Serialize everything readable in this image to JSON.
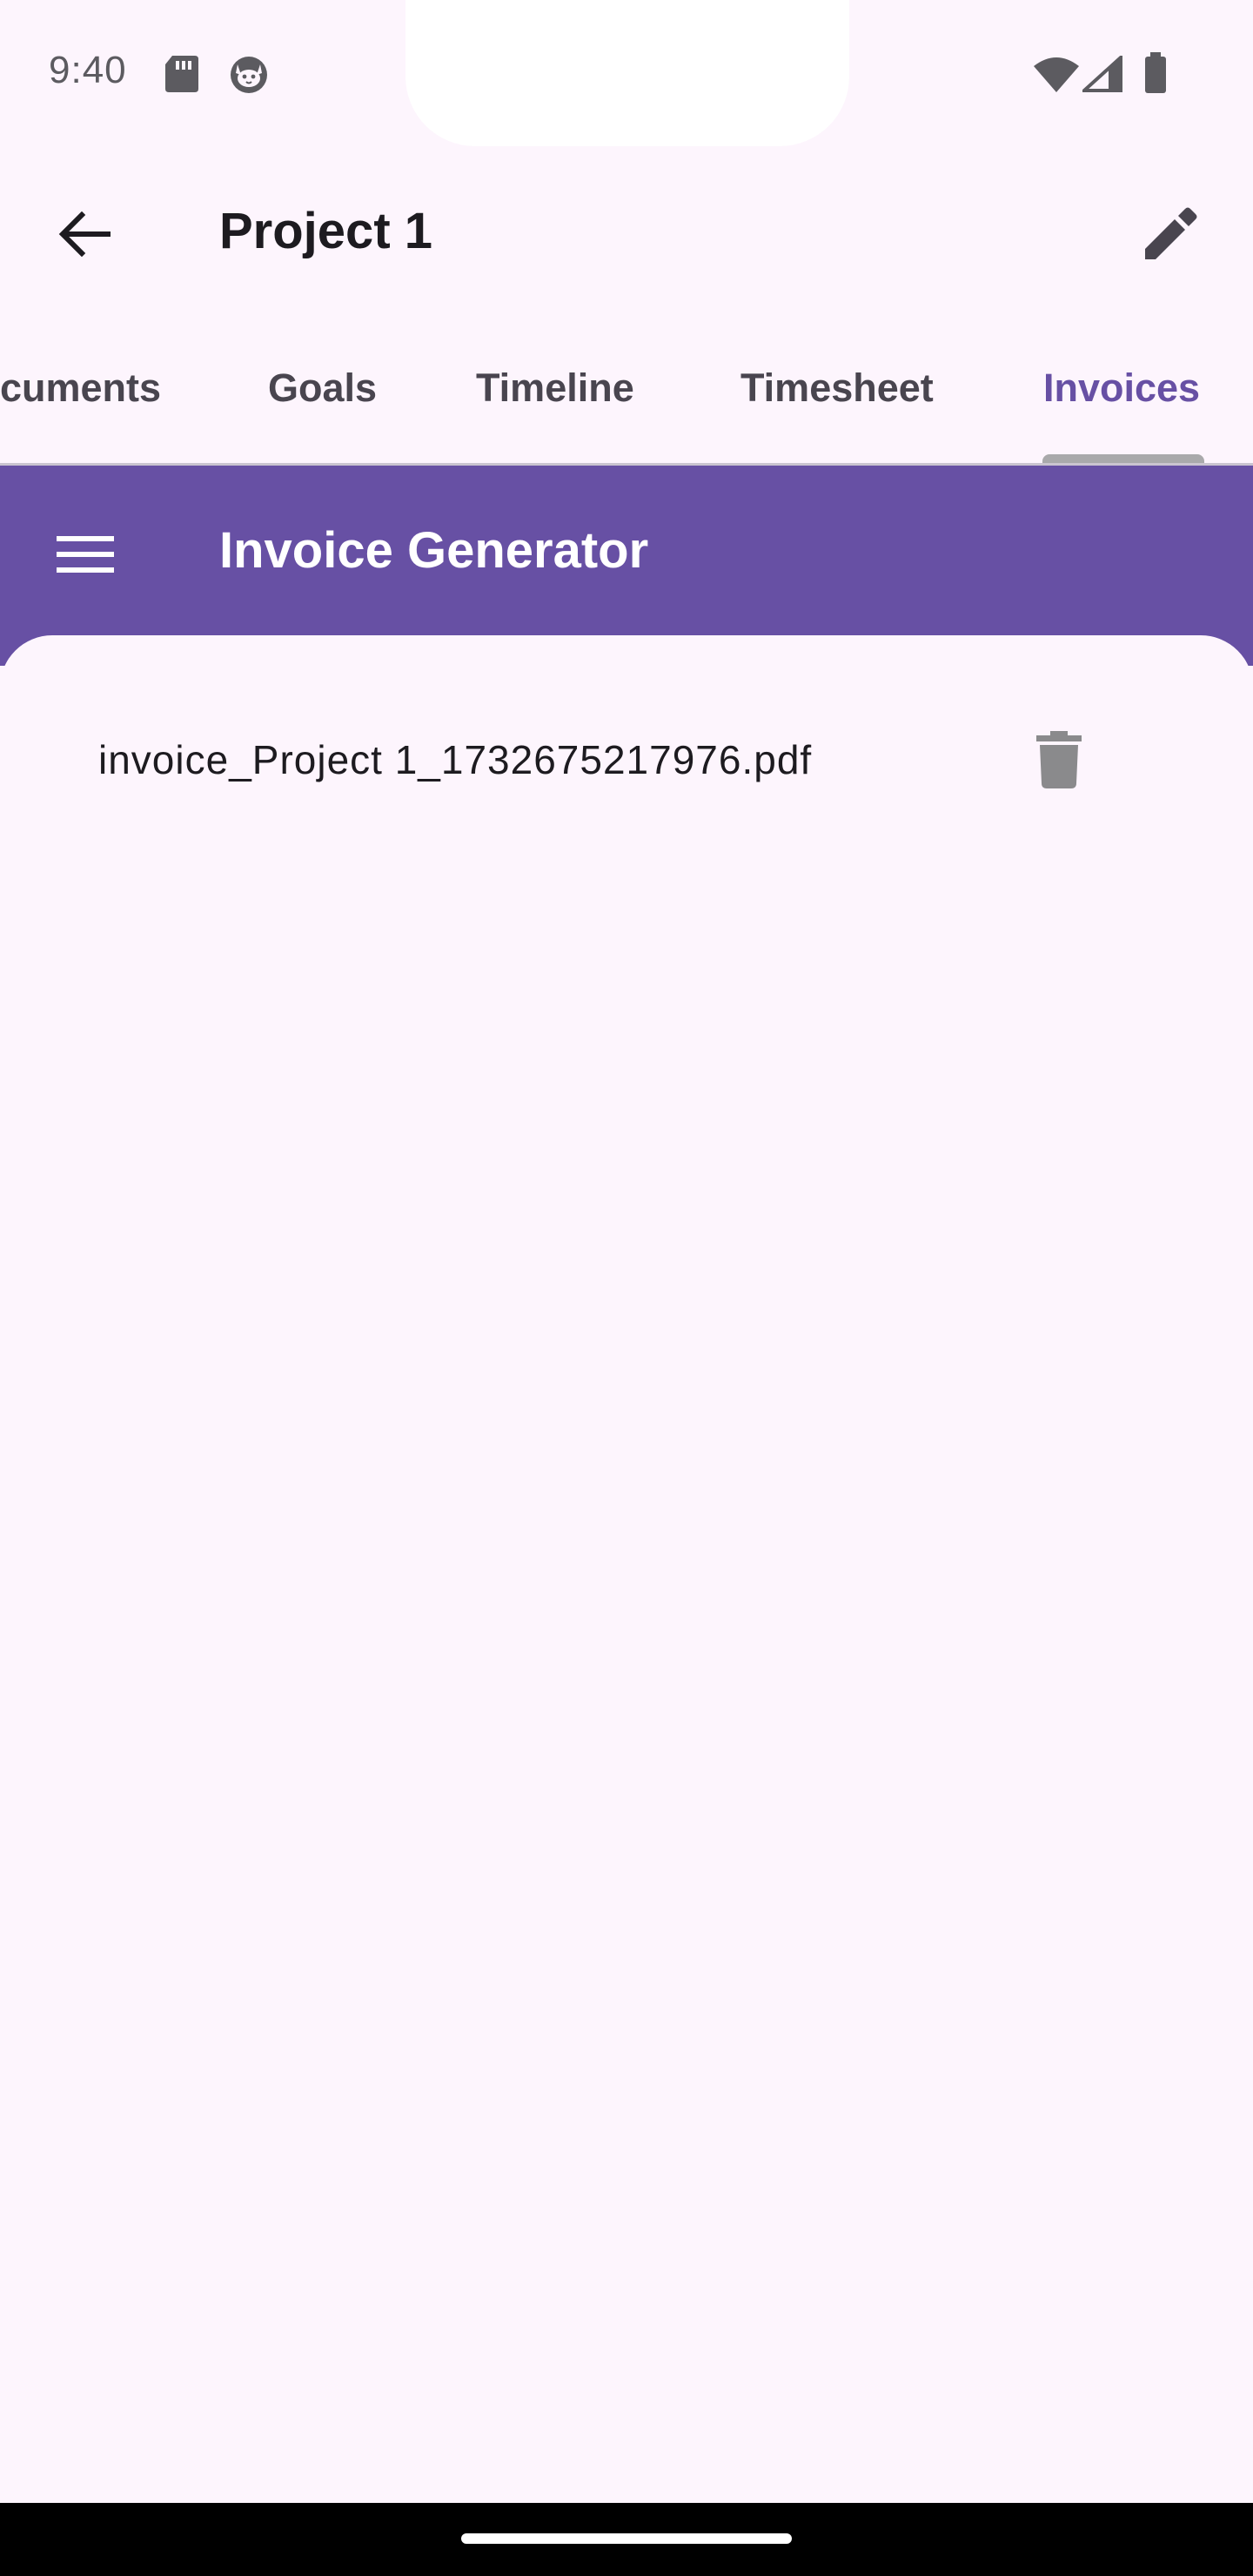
{
  "status_bar": {
    "time": "9:40",
    "icons": [
      "sd-card-icon",
      "cat-face-icon",
      "wifi-icon",
      "cell-signal-icon",
      "battery-icon"
    ]
  },
  "app_bar": {
    "title": "Project 1",
    "back_icon": "arrow-back-icon",
    "edit_icon": "pencil-icon"
  },
  "tabs": {
    "items": [
      {
        "label": "cuments"
      },
      {
        "label": "Goals"
      },
      {
        "label": "Timeline"
      },
      {
        "label": "Timesheet"
      },
      {
        "label": "Invoices",
        "active": true
      }
    ]
  },
  "generator": {
    "title": "Invoice Generator",
    "menu_icon": "hamburger-menu-icon"
  },
  "invoices": [
    {
      "filename": "invoice_Project 1_1732675217976.pdf",
      "action_icon": "trash-icon"
    }
  ],
  "colors": {
    "accent": "#6750a4",
    "background": "#fdf5fd",
    "tab_text": "#49454f",
    "indicator": "#a9a9ab",
    "trash": "#8a8a8c"
  }
}
